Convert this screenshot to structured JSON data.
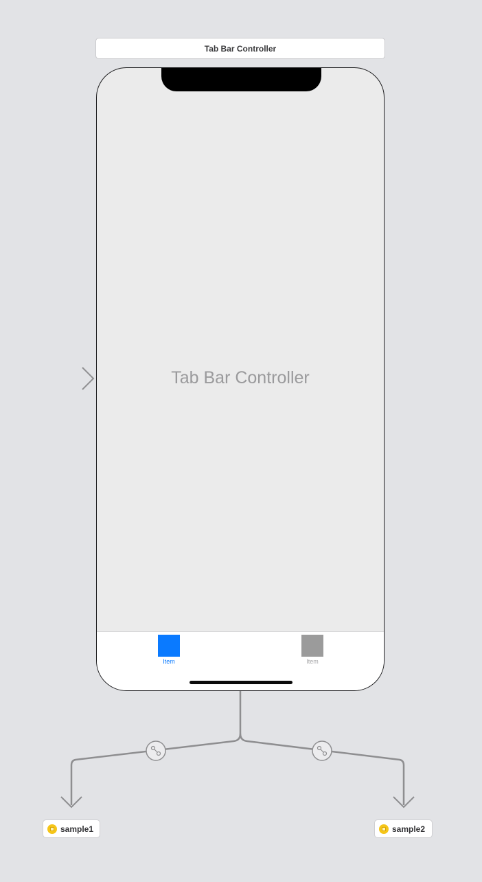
{
  "scene": {
    "title": "Tab Bar Controller",
    "center_label": "Tab Bar Controller"
  },
  "tabbar": {
    "items": [
      {
        "label": "Item",
        "state": "selected",
        "color": "#0a7aff"
      },
      {
        "label": "Item",
        "state": "normal",
        "color": "#9b9b9b"
      }
    ]
  },
  "references": [
    {
      "label": "sample1",
      "icon": "storyboard-reference-icon"
    },
    {
      "label": "sample2",
      "icon": "storyboard-reference-icon"
    }
  ],
  "colors": {
    "canvas": "#e2e3e6",
    "accent": "#0a7aff",
    "segue": "#8e8e90"
  }
}
